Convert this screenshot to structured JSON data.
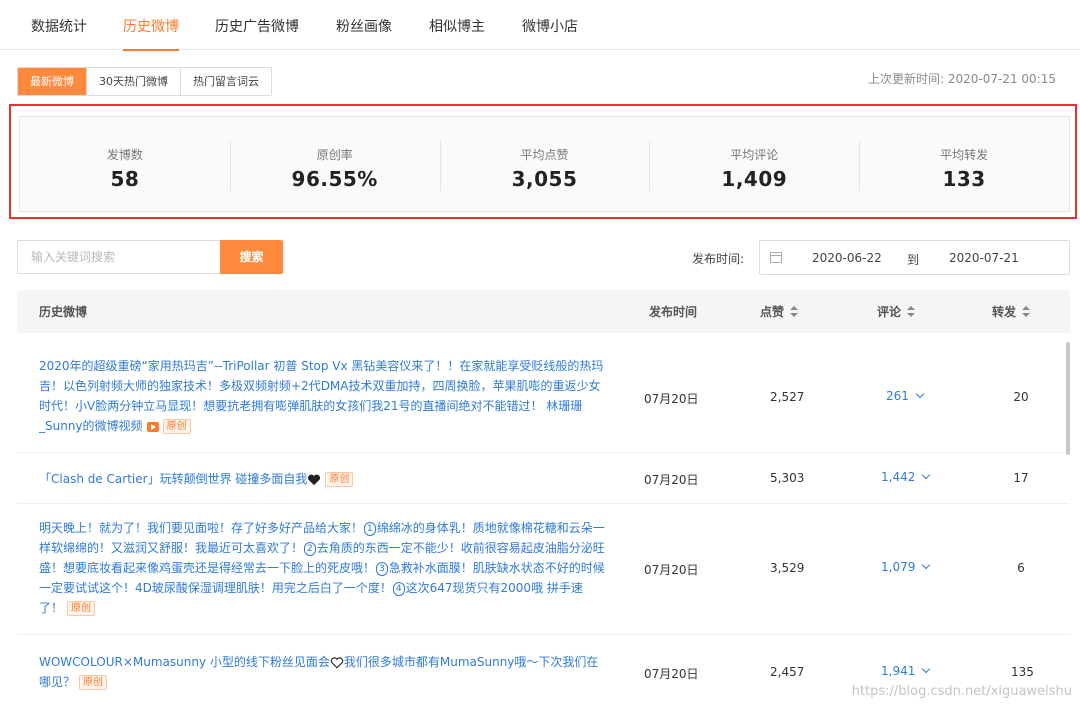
{
  "nav": {
    "tabs": [
      {
        "label": "数据统计"
      },
      {
        "label": "历史微博"
      },
      {
        "label": "历史广告微博"
      },
      {
        "label": "粉丝画像"
      },
      {
        "label": "相似博主"
      },
      {
        "label": "微博小店"
      }
    ],
    "active": "历史微博"
  },
  "subtabs": [
    {
      "label": "最新微博"
    },
    {
      "label": "30天热门微博"
    },
    {
      "label": "热门留言词云"
    }
  ],
  "updated": "上次更新时间: 2020-07-21 00:15",
  "stats": [
    {
      "label": "发博数",
      "value": "58"
    },
    {
      "label": "原创率",
      "value": "96.55%"
    },
    {
      "label": "平均点赞",
      "value": "3,055"
    },
    {
      "label": "平均评论",
      "value": "1,409"
    },
    {
      "label": "平均转发",
      "value": "133"
    }
  ],
  "search": {
    "placeholder": "输入关键词搜索",
    "button": "搜索"
  },
  "date_filter": {
    "label": "发布时间:",
    "start": "2020-06-22",
    "to": "到",
    "end": "2020-07-21"
  },
  "table": {
    "headers": {
      "post": "历史微博",
      "time": "发布时间",
      "likes": "点赞",
      "comments": "评论",
      "reposts": "转发"
    },
    "orig_label": "原创",
    "rows": [
      {
        "text": "2020年的超级重磅“家用热玛吉”--TriPollar 初普 Stop Vx 黑钻美容仪来了！！在家就能享受贬线般的热玛吉！以色列射频大师的独家技术！多极双频射频+2代DMA技术双重加持，四周换脸，苹果肌嘭的重返少女时代！小V脸两分钟立马显现！想要抗老拥有嘭弹肌肤的女孩们我21号的直播间绝对不能错过！ 林珊珊_Sunny的微博视频",
        "date": "07月20日",
        "likes": "2,527",
        "comments": "261",
        "reposts": "20"
      },
      {
        "text": "「Clash de Cartier」玩转颠倒世界 碰撞多面自我",
        "date": "07月20日",
        "likes": "5,303",
        "comments": "1,442",
        "reposts": "17"
      },
      {
        "segments": [
          "明天晚上！就为了！我们要见面啦！存了好多好产品给大家！",
          "1",
          "绵绵冰的身体乳！质地就像棉花糖和云朵一样软绵绵的！又滋润又舒服！我最近可太喜欢了！",
          "2",
          "去角质的东西一定不能少！收前很容易起皮油脂分泌旺盛！想要底妆看起来像鸡蛋壳还是得经常去一下脸上的死皮哦！",
          "3",
          "急救补水面膜！肌肤缺水状态不好的时候一定要试试这个！4D玻尿酸保湿调理肌肤！用完之后白了一个度！",
          "4",
          "这次647现货只有2000哦 拼手速了！"
        ],
        "date": "07月20日",
        "likes": "3,529",
        "comments": "1,079",
        "reposts": "6"
      },
      {
        "segments": [
          "WOWCOLOUR×Mumasunny 小型的线下粉丝见面会",
          "我们很多城市都有MumaSunny哦～下次我们在哪见？"
        ],
        "date": "07月20日",
        "likes": "2,457",
        "comments": "1,941",
        "reposts": "135"
      }
    ]
  },
  "watermark": "https://blog.csdn.net/xiguawelshu"
}
